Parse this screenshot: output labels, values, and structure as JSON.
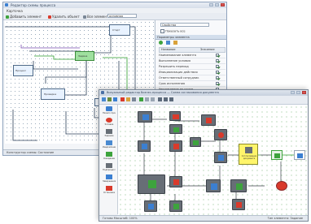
{
  "back_window": {
    "title": "Редактор схемы процесса",
    "menu_label": "Карточка",
    "toolbar": {
      "btn1_label": "Добавить элемент",
      "btn2_label": "Удалить объект",
      "btn3_label": "Все элементы",
      "combo_value": "основная"
    },
    "panel": {
      "combo_value": "Свойства",
      "checkbox_label": "Показать все",
      "section_title": "Параметры элемента",
      "col_name": "Название",
      "col_value": "Значение",
      "rows": [
        {
          "label": "Наименование элемента",
          "checked": true
        },
        {
          "label": "Выполнение условия",
          "checked": true
        },
        {
          "label": "Разрешить переход",
          "checked": true
        },
        {
          "label": "Инициализация действия",
          "checked": true
        },
        {
          "label": "Ответственный сотрудник",
          "checked": true
        },
        {
          "label": "Срок исполнения",
          "checked": true
        },
        {
          "label": "Уведомление по почте",
          "checked": false
        },
        {
          "label": "Автозапуск",
          "checked": true
        }
      ]
    },
    "nodes": [
      "Старт",
      "Процесс",
      "Задача",
      "Проверка"
    ],
    "status_left": "Конструктор схемы: Состояние"
  },
  "front_window": {
    "title": "Визуальный редактор бизнес-процесса — Схема согласования документа",
    "side_items": [
      "Начало процесса",
      "Условие",
      "Задание",
      "Уведомление",
      "Ожидание",
      "Подпроцесс",
      "Завершение",
      "Остановка"
    ],
    "status_left": "Готово  Масштаб: 100%",
    "status_right": "Тип элемента: Задание",
    "center_node_label": "Согласование документа"
  },
  "colors": {
    "border": "#8fa3bd",
    "accent_blue": "#3b7fd1",
    "node_gray": "#676e76",
    "highlight_yellow": "#fff56a",
    "stop_red": "#d93a2b",
    "green": "#3da33d"
  }
}
